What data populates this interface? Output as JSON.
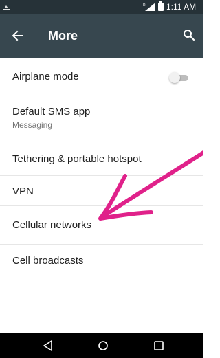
{
  "status_bar": {
    "time": "1:11 AM"
  },
  "app_bar": {
    "title": "More"
  },
  "settings": [
    {
      "label": "Airplane mode",
      "toggle": false
    },
    {
      "label": "Default SMS app",
      "subtitle": "Messaging"
    },
    {
      "label": "Tethering & portable hotspot"
    },
    {
      "label": "VPN"
    },
    {
      "label": "Cellular networks"
    },
    {
      "label": "Cell broadcasts"
    }
  ],
  "icons": {
    "back": "arrow-left",
    "search": "magnifier",
    "nav_back": "triangle-left",
    "nav_home": "circle",
    "nav_recent": "square"
  },
  "colors": {
    "status_bar": "#263238",
    "app_bar": "#37474f",
    "annotation_arrow": "#e0218a"
  }
}
